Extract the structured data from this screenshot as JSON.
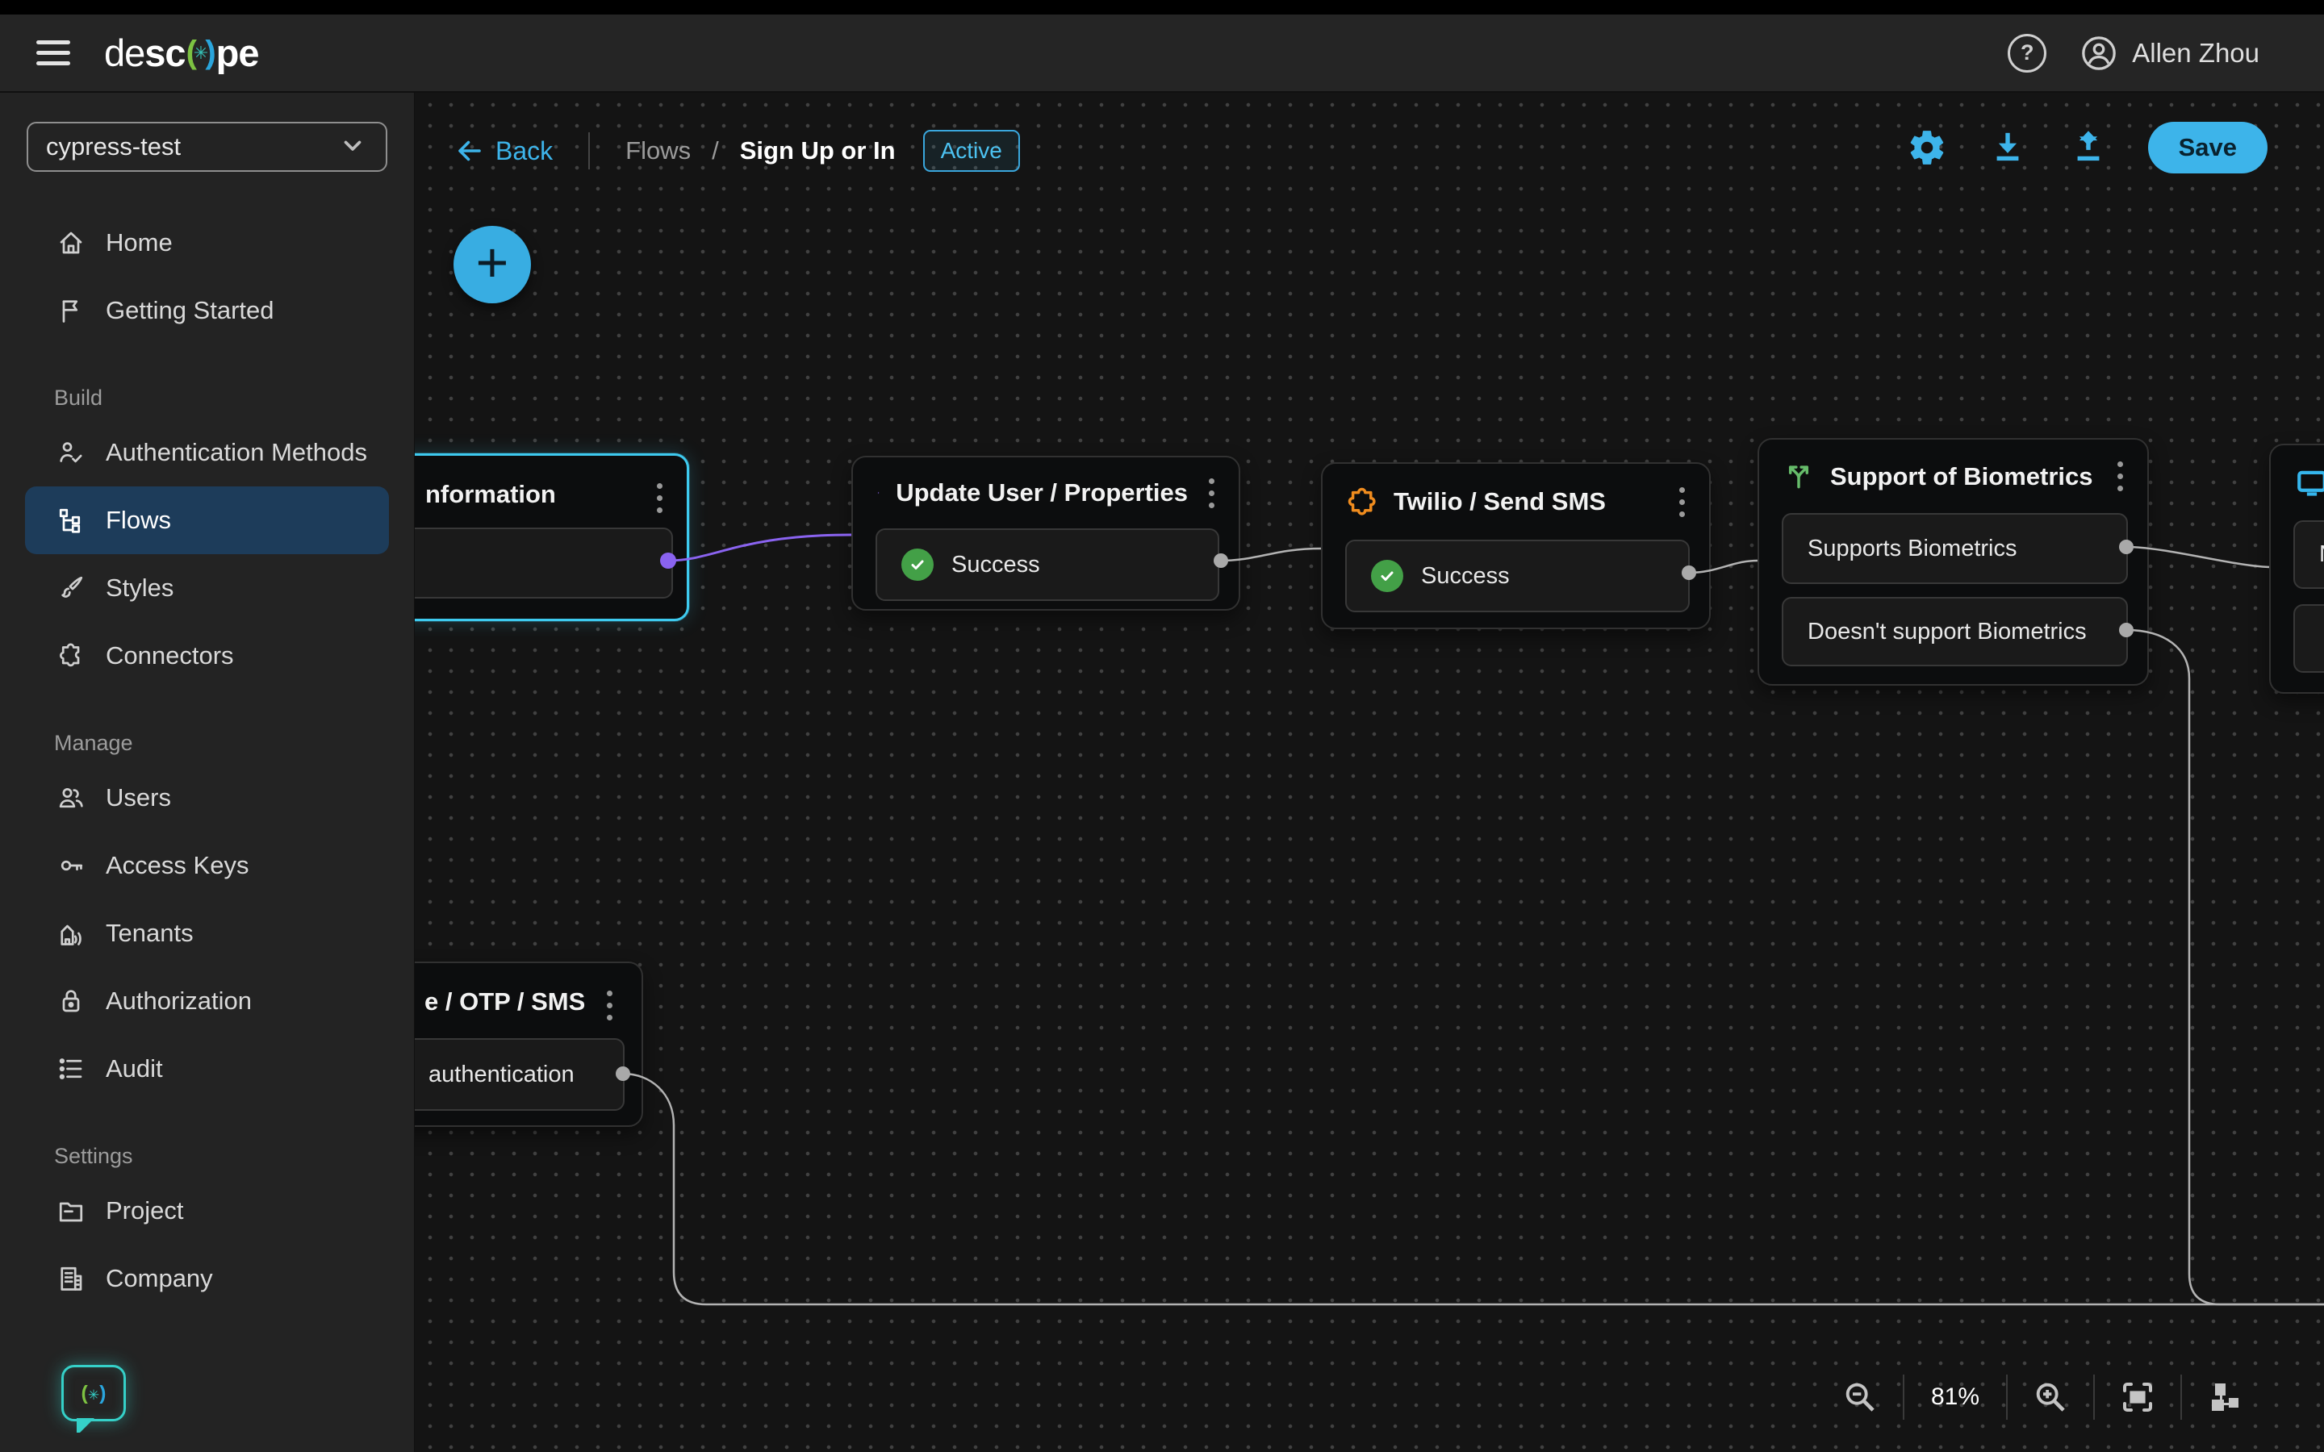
{
  "topbar": {
    "logo": {
      "de": "de",
      "sc": "sc",
      "pe": "pe"
    },
    "user_name": "Allen Zhou"
  },
  "sidebar": {
    "project": "cypress-test",
    "items": [
      {
        "label": "Home",
        "icon": "home"
      },
      {
        "label": "Getting Started",
        "icon": "flag"
      },
      {
        "section": "Build"
      },
      {
        "label": "Authentication Methods",
        "icon": "auth"
      },
      {
        "label": "Flows",
        "icon": "flows",
        "active": true
      },
      {
        "label": "Styles",
        "icon": "brush"
      },
      {
        "label": "Connectors",
        "icon": "puzzle"
      },
      {
        "section": "Manage"
      },
      {
        "label": "Users",
        "icon": "users"
      },
      {
        "label": "Access Keys",
        "icon": "key"
      },
      {
        "label": "Tenants",
        "icon": "tenants"
      },
      {
        "label": "Authorization",
        "icon": "lock"
      },
      {
        "label": "Audit",
        "icon": "audit"
      },
      {
        "section": "Settings"
      },
      {
        "label": "Project",
        "icon": "folder"
      },
      {
        "label": "Company",
        "icon": "company"
      }
    ]
  },
  "toolbar": {
    "back": "Back",
    "breadcrumb_root": "Flows",
    "breadcrumb_sep": "/",
    "flow_name": "Sign Up or In",
    "status_badge": "Active",
    "save": "Save"
  },
  "nodes": {
    "information": {
      "title_fragment": "nformation"
    },
    "update_user": {
      "title": "Update User / Properties",
      "icon": "lightning-icon",
      "row": "Success"
    },
    "twilio": {
      "title": "Twilio / Send SMS",
      "icon": "puzzle-icon",
      "row": "Success"
    },
    "biometrics": {
      "title": "Support of Biometrics",
      "icon": "branch-icon",
      "row1": "Supports Biometrics",
      "row2": "Doesn't support Biometrics"
    },
    "screen": {
      "icon": "monitor-icon",
      "row1_fragment": "N"
    },
    "otp_sms": {
      "title_fragment": "e / OTP / SMS",
      "row_fragment": "authentication"
    }
  },
  "controls": {
    "zoom_level": "81%"
  },
  "colors": {
    "accent_blue": "#3db4ea",
    "selection_cyan": "#3ecaef",
    "purple": "#8a63f0",
    "orange": "#f08c1e",
    "success_green": "#43a047",
    "branch_green": "#66bb6a",
    "glow_teal": "#35d0c8",
    "edge_gray": "#b3b3b3",
    "active_item_bg": "#1d3c5a"
  }
}
